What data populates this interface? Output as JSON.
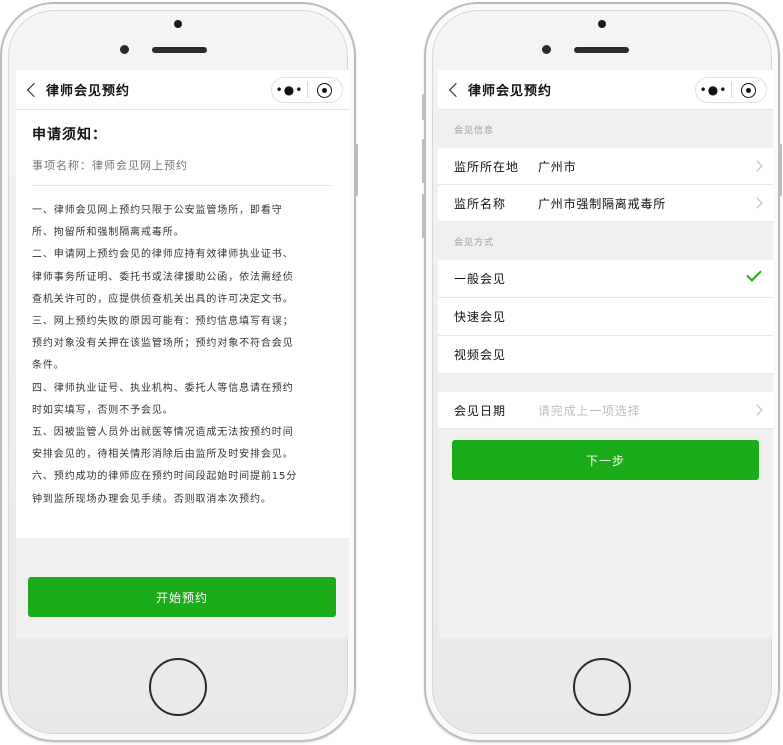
{
  "left_screen": {
    "nav": {
      "title": "律师会见预约",
      "more_icon": "more-dots-icon",
      "close_icon": "target-icon"
    },
    "notice": {
      "title": "申请须知：",
      "subtitle": "事项名称：律师会见网上预约",
      "lines": [
        "一、律师会见网上预约只限于公安监管场所，即看守",
        "所、拘留所和强制隔离戒毒所。",
        "二、申请网上预约会见的律师应持有效律师执业证书、",
        "律师事务所证明、委托书或法律援助公函，依法需经侦",
        "查机关许可的，应提供侦查机关出具的许可决定文书。",
        "三、网上预约失败的原因可能有：预约信息填写有误；",
        "预约对象没有关押在该监管场所；预约对象不符合会见",
        "条件。",
        "四、律师执业证号、执业机构、委托人等信息请在预约",
        "时如实填写，否则不予会见。",
        "五、因被监管人员外出就医等情况造成无法按预约时间",
        "安排会见的，待相关情形消除后由监所及时安排会见。",
        "六、预约成功的律师应在预约时间段起始时间提前15分",
        "钟到监所现场办理会见手续。否则取消本次预约。"
      ]
    },
    "start_button": "开始预约"
  },
  "right_screen": {
    "nav": {
      "title": "律师会见预约",
      "more_icon": "more-dots-icon",
      "close_icon": "target-icon"
    },
    "info_group_label": "会见信息",
    "location_row": {
      "label": "监所所在地",
      "value": "广州市"
    },
    "name_row": {
      "label": "监所名称",
      "value": "广州市强制隔离戒毒所"
    },
    "method_group_label": "会见方式",
    "methods": [
      {
        "label": "一般会见",
        "selected": true
      },
      {
        "label": "快速会见",
        "selected": false
      },
      {
        "label": "视频会见",
        "selected": false
      }
    ],
    "date_row": {
      "label": "会见日期",
      "placeholder": "请完成上一项选择"
    },
    "next_button": "下一步"
  },
  "colors": {
    "accent": "#1aad19",
    "background": "#f0f0f0",
    "text": "#111111",
    "placeholder": "#bdbdbd"
  }
}
